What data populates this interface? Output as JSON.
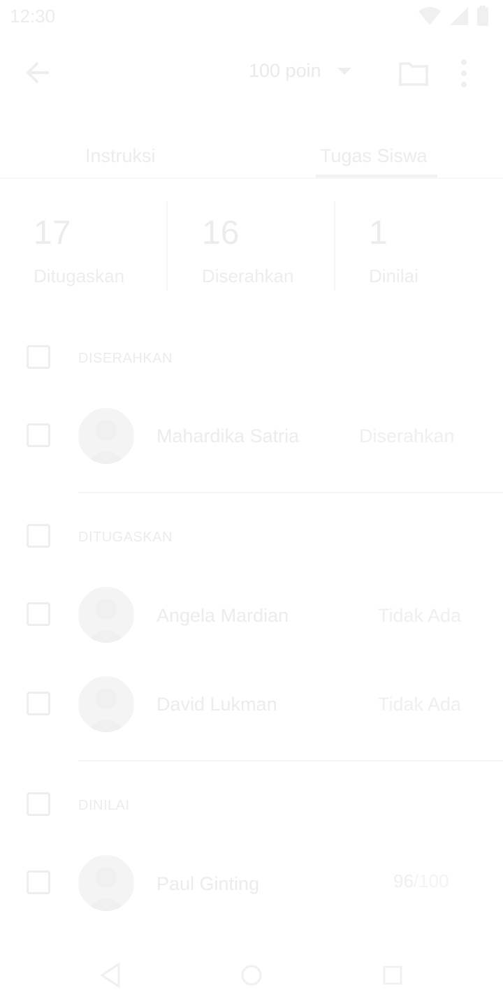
{
  "status_bar": {
    "time": "12:30"
  },
  "app_bar": {
    "points_label": "100 poin"
  },
  "tabs": [
    {
      "label": "Instruksi"
    },
    {
      "label": "Tugas Siswa"
    }
  ],
  "stats": [
    {
      "value": "17",
      "label": "Ditugaskan"
    },
    {
      "value": "16",
      "label": "Diserahkan"
    },
    {
      "value": "1",
      "label": "Dinilai"
    }
  ],
  "sections": {
    "submitted": {
      "label": "DISERAHKAN",
      "students": [
        {
          "name": "Mahardika Satria",
          "status": "Diserahkan"
        }
      ]
    },
    "assigned": {
      "label": "DITUGASKAN",
      "students": [
        {
          "name": "Angela Mardian",
          "status": "Tidak Ada"
        },
        {
          "name": "David Lukman",
          "status": "Tidak Ada"
        }
      ]
    },
    "graded": {
      "label": "DINILAI",
      "students": [
        {
          "name": "Paul Ginting",
          "score": "96",
          "score_total": "/100"
        }
      ]
    }
  },
  "colors": {
    "background": "#ffffff",
    "faded_text": "#ececec",
    "faded_line": "#f6f6f6"
  }
}
